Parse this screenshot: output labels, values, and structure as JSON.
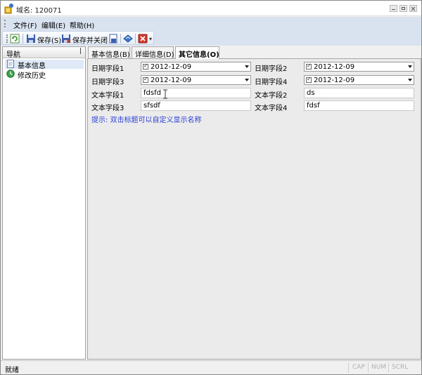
{
  "window": {
    "title": "域名: 120071",
    "icons": {
      "app": "app-icon",
      "minimize": "minimize-icon",
      "maximize": "maximize-icon",
      "close": "close-icon"
    }
  },
  "menu": {
    "items": [
      {
        "label": "文件(F)"
      },
      {
        "label": "编辑(E)"
      },
      {
        "label": "帮助(H)"
      }
    ]
  },
  "toolbar": {
    "refresh_icon": "refresh-icon",
    "save_label": "保存(S)",
    "save_close_label": "保存并关闭",
    "overflow_glyph": "▾"
  },
  "nav": {
    "title": "导航",
    "pin_glyph": "ꟾ",
    "items": [
      {
        "label": "基本信息",
        "icon": "document-icon",
        "selected": true
      },
      {
        "label": "修改历史",
        "icon": "history-icon",
        "selected": false
      }
    ]
  },
  "tabs": [
    {
      "label": "基本信息(B)",
      "active": false
    },
    {
      "label": "详细信息(D)",
      "active": false
    },
    {
      "label": "其它信息(O)",
      "active": true
    }
  ],
  "form": {
    "date1_label": "日期字段1",
    "date1_value": "2012-12-09",
    "date2_label": "日期字段2",
    "date2_value": "2012-12-09",
    "date3_label": "日期字段3",
    "date3_value": "2012-12-09",
    "date4_label": "日期字段4",
    "date4_value": "2012-12-09",
    "text1_label": "文本字段1",
    "text1_value": "fdsfd",
    "text2_label": "文本字段2",
    "text2_value": "ds",
    "text3_label": "文本字段3",
    "text3_value": "sfsdf",
    "text4_label": "文本字段4",
    "text4_value": "fdsf",
    "hint": "提示: 双击标题可以自定义显示名称"
  },
  "status": {
    "text": "就绪",
    "indicators": [
      "CAP",
      "NUM",
      "SCRL"
    ]
  },
  "colors": {
    "toolbar_bg": "#d9e3f0",
    "hint_text": "#2a3fd6",
    "selected_bg": "#dfe9f7"
  }
}
